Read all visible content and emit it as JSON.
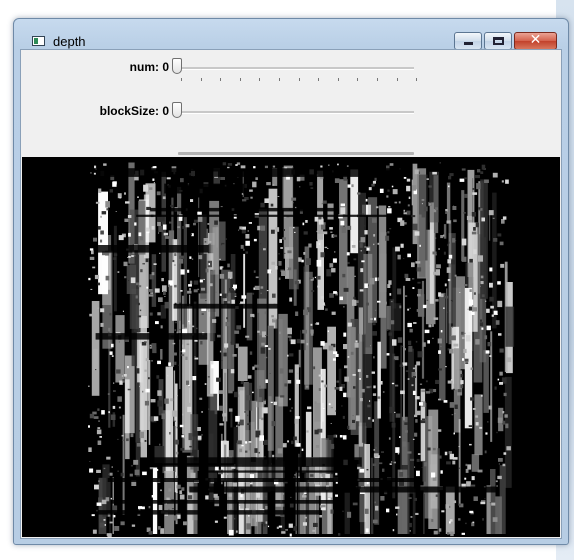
{
  "window": {
    "title": "depth",
    "controls": [
      "minimize-icon",
      "maximize-icon",
      "close-icon"
    ],
    "close_glyph": "✕"
  },
  "trackbars": [
    {
      "label": "num: 0",
      "value": 0
    },
    {
      "label": "blockSize: 0",
      "value": 0
    }
  ],
  "image": {
    "name": "disparity-map",
    "background": "#000000"
  }
}
